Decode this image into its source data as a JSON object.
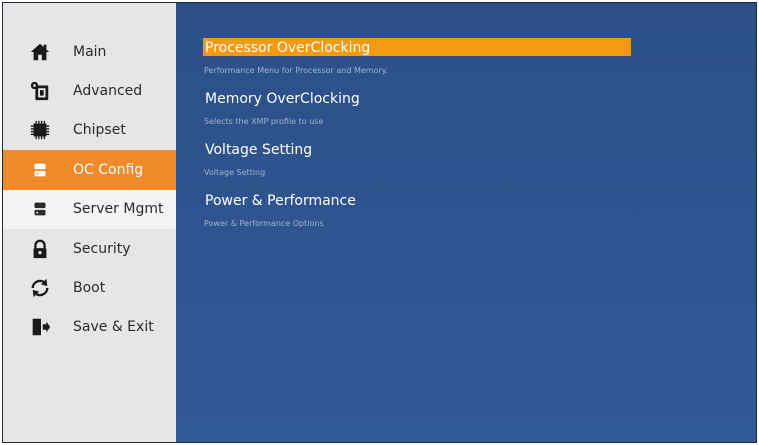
{
  "sidebar": {
    "items": [
      {
        "label": "Main",
        "icon": "home-icon"
      },
      {
        "label": "Advanced",
        "icon": "gear-icon"
      },
      {
        "label": "Chipset",
        "icon": "chip-icon"
      },
      {
        "label": "OC Config",
        "icon": "server-icon"
      },
      {
        "label": "Server Mgmt",
        "icon": "server-icon"
      },
      {
        "label": "Security",
        "icon": "lock-icon"
      },
      {
        "label": "Boot",
        "icon": "refresh-icon"
      },
      {
        "label": "Save & Exit",
        "icon": "exit-icon"
      }
    ],
    "active_index": 3
  },
  "main": {
    "menu": [
      {
        "title": "Processor OverClocking",
        "desc": "Performance Menu for Processor and Memory."
      },
      {
        "title": "Memory OverClocking",
        "desc": "Selects the XMP profile to use"
      },
      {
        "title": "Voltage Setting",
        "desc": "Voltage Setting"
      },
      {
        "title": "Power & Performance",
        "desc": "Power & Performance Options"
      }
    ]
  },
  "colors": {
    "accent": "#f08a2b",
    "highlight": "#f39a10",
    "panel": "#2f5591",
    "sidebar": "#e6e6e6"
  }
}
